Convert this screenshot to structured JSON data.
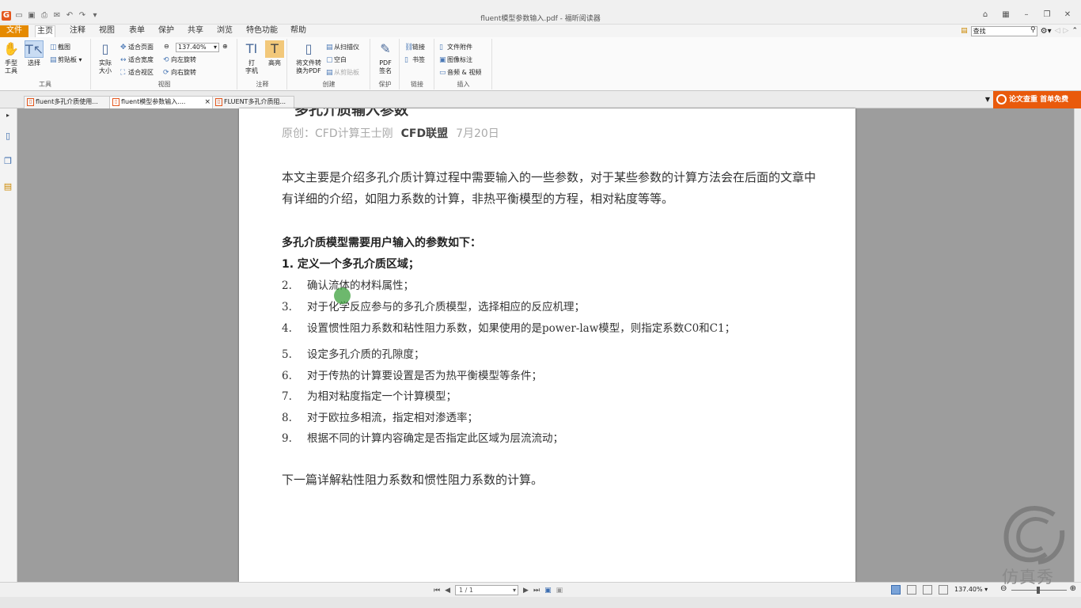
{
  "window": {
    "title": "fluent模型参数输入.pdf - 福昕阅读器"
  },
  "menu": {
    "file": "文件",
    "items": [
      "主页",
      "注释",
      "视图",
      "表单",
      "保护",
      "共享",
      "浏览",
      "特色功能",
      "帮助"
    ],
    "search_value": "查找"
  },
  "ribbon": {
    "hand": "手型\n工具",
    "select": "选择",
    "screenshot": "截图",
    "clipboard": "剪贴板",
    "group_tools": "工具",
    "actual_size": "实际\n大小",
    "fit_page": "适合页面",
    "fit_width": "适合宽度",
    "fit_view": "适合视区",
    "zoom": "137.40%",
    "rotate_left": "向左旋转",
    "rotate_right": "向右旋转",
    "group_view": "视图",
    "typewriter": "打\n字机",
    "highlight": "高亮",
    "group_comment": "注释",
    "convert": "将文件转\n换为PDF",
    "from_scanner": "从扫描仪",
    "blank": "空白",
    "from_clipboard": "从剪贴板",
    "group_create": "创建",
    "pdf_sign": "PDF\n签名",
    "group_protect": "保护",
    "link": "链接",
    "bookmark": "书签",
    "group_link": "链接",
    "attachment": "文件附件",
    "image_annot": "图像标注",
    "audio_video": "音频 & 视频",
    "group_insert": "插入"
  },
  "tabs": [
    "fluent多孔介质使用...",
    "fluent模型参数输入....",
    "FLUENT多孔介质阻..."
  ],
  "promo": "论文查重  首单免费",
  "document": {
    "heading_fragment": "多孔介质输入参数",
    "byline_prefix": "原创：CFD计算王士刚",
    "account": "CFD联盟",
    "date": "7月20日",
    "intro": "本文主要是介绍多孔介质计算过程中需要输入的一些参数，对于某些参数的计算方法会在后面的文章中有详细的介绍，如阻力系数的计算，非热平衡模型的方程，相对粘度等等。",
    "params_heading": "多孔介质模型需要用户输入的参数如下：",
    "step1": "1. 定义一个多孔介质区域；",
    "items": [
      {
        "n": "2.",
        "t": "确认流体的材料属性；"
      },
      {
        "n": "3.",
        "t": "对于化学反应参与的多孔介质模型，选择相应的反应机理；"
      },
      {
        "n": "4.",
        "t": "设置惯性阻力系数和粘性阻力系数，如果使用的是power-law模型，则指定系数C0和C1；"
      },
      {
        "n": "5.",
        "t": "设定多孔介质的孔隙度；"
      },
      {
        "n": "6.",
        "t": "对于传热的计算要设置是否为热平衡模型等条件；"
      },
      {
        "n": "7.",
        "t": "为相对粘度指定一个计算模型；"
      },
      {
        "n": "8.",
        "t": "对于欧拉多相流，指定相对渗透率；"
      },
      {
        "n": "9.",
        "t": "根据不同的计算内容确定是否指定此区域为层流流动；"
      }
    ],
    "closing": "下一篇详解粘性阻力系数和惯性阻力系数的计算。"
  },
  "status": {
    "page": "1 / 1",
    "zoom": "137.40%"
  },
  "watermark": "仿真秀"
}
